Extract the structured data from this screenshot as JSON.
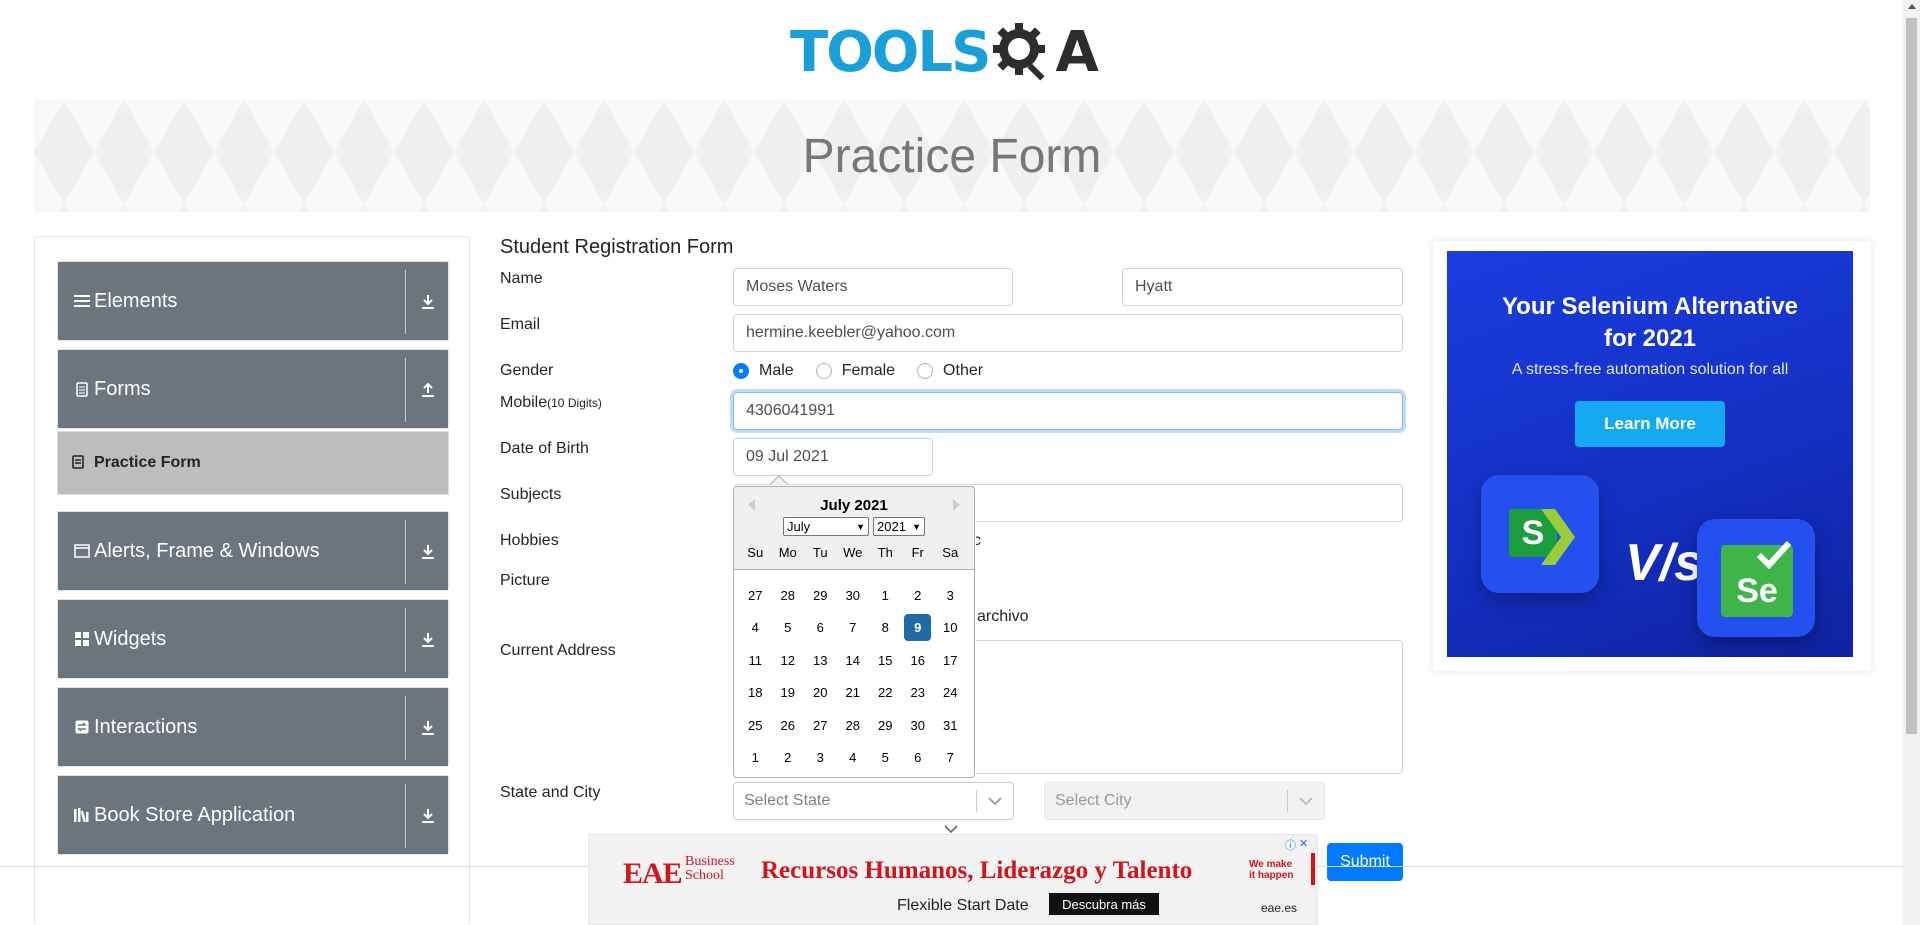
{
  "logo": {
    "text": "TOOLS",
    "suffix": "A"
  },
  "banner": {
    "title": "Practice Form"
  },
  "sidebar": {
    "groups": [
      {
        "label": "Elements",
        "icon": "hamburger-icon",
        "arrow": "download-icon"
      },
      {
        "label": "Forms",
        "icon": "document-icon",
        "arrow": "upload-icon"
      },
      {
        "label": "Alerts, Frame & Windows",
        "icon": "window-icon",
        "arrow": "download-icon"
      },
      {
        "label": "Widgets",
        "icon": "grid-icon",
        "arrow": "download-icon"
      },
      {
        "label": "Interactions",
        "icon": "swap-icon",
        "arrow": "download-icon"
      },
      {
        "label": "Book Store Application",
        "icon": "books-icon",
        "arrow": "download-icon"
      }
    ],
    "active_item": {
      "label": "Practice Form",
      "icon": "form-icon"
    }
  },
  "form": {
    "title": "Student Registration Form",
    "labels": {
      "name": "Name",
      "email": "Email",
      "gender": "Gender",
      "mobile": "Mobile",
      "mobile_hint": "(10 Digits)",
      "dob": "Date of Birth",
      "subjects": "Subjects",
      "hobbies": "Hobbies",
      "picture": "Picture",
      "address": "Current Address",
      "state_city": "State and City"
    },
    "first_name": "Moses Waters",
    "last_name": "Hyatt",
    "email": "hermine.keebler@yahoo.com",
    "gender_options": [
      "Male",
      "Female",
      "Other"
    ],
    "gender_selected": "Male",
    "mobile": "4306041991",
    "dob": "09 Jul 2021",
    "hobbies_partial": "c",
    "picture_partial": "archivo",
    "state_placeholder": "Select State",
    "city_placeholder": "Select City",
    "submit_label": "Submit"
  },
  "calendar": {
    "month_title": "July 2021",
    "month_select": "July",
    "year_select": "2021",
    "weekdays": [
      "Su",
      "Mo",
      "Tu",
      "We",
      "Th",
      "Fr",
      "Sa"
    ],
    "weeks": [
      [
        "27",
        "28",
        "29",
        "30",
        "1",
        "2",
        "3"
      ],
      [
        "4",
        "5",
        "6",
        "7",
        "8",
        "9",
        "10"
      ],
      [
        "11",
        "12",
        "13",
        "14",
        "15",
        "16",
        "17"
      ],
      [
        "18",
        "19",
        "20",
        "21",
        "22",
        "23",
        "24"
      ],
      [
        "25",
        "26",
        "27",
        "28",
        "29",
        "30",
        "31"
      ],
      [
        "1",
        "2",
        "3",
        "4",
        "5",
        "6",
        "7"
      ]
    ],
    "selected_day": "9"
  },
  "right_ad": {
    "title_line1": "Your Selenium Alternative",
    "title_line2": "for 2021",
    "subtitle": "A stress-free automation solution for all",
    "button": "Learn More",
    "vs": "V/s",
    "tile_left": "S",
    "tile_right": "Se"
  },
  "bottom_ad": {
    "logo": "EAE",
    "school_line1": "Business",
    "school_line2": "School",
    "headline": "Recursos Humanos, Liderazgo y Talento",
    "magic_line1": "We make",
    "magic_line2": "it happen",
    "tagline": "Flexible Start Date",
    "cta": "Descubra más",
    "url": "eae.es"
  },
  "colors": {
    "brand": "#1a9fd8",
    "sidebar": "#6c757d",
    "primary": "#007bff",
    "calendar_selected": "#216ba5"
  }
}
